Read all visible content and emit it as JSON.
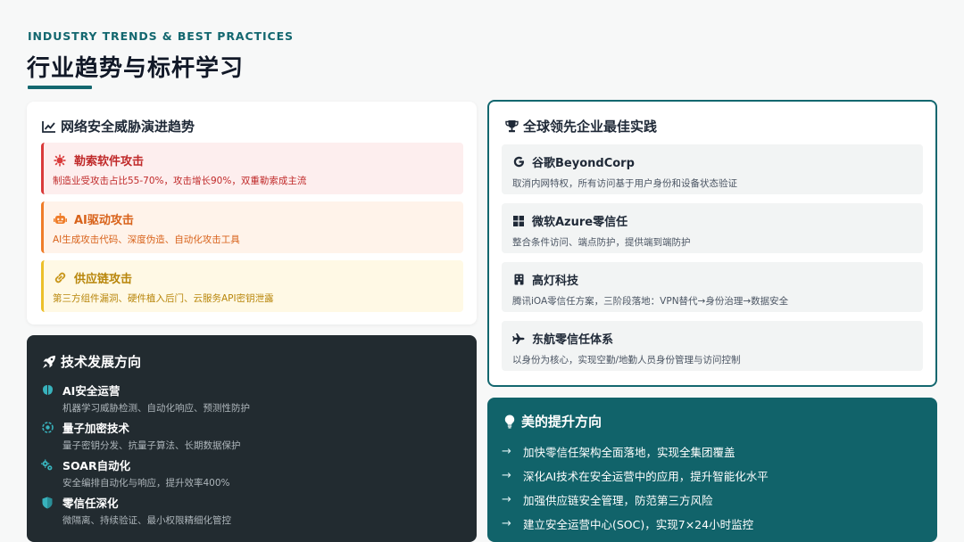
{
  "header": {
    "eyebrow": "INDUSTRY TRENDS & BEST PRACTICES",
    "title": "行业趋势与标杆学习"
  },
  "threats": {
    "title": "网络安全威胁演进趋势",
    "icon": "trend-chart-icon",
    "items": [
      {
        "title": "勒索软件攻击",
        "desc": "制造业受攻击占比55-70%，攻击增长90%，双重勒索成主流",
        "icon": "virus-icon",
        "color": "#d93a3a"
      },
      {
        "title": "AI驱动攻击",
        "desc": "AI生成攻击代码、深度伪造、自动化攻击工具",
        "icon": "robot-icon",
        "color": "#ef7d2a"
      },
      {
        "title": "供应链攻击",
        "desc": "第三方组件漏洞、硬件植入后门、云服务API密钥泄露",
        "icon": "link-icon",
        "color": "#ecc02a"
      }
    ]
  },
  "tech": {
    "title": "技术发展方向",
    "icon": "rocket-icon",
    "items": [
      {
        "title": "AI安全运营",
        "desc": "机器学习威胁检测、自动化响应、预测性防护",
        "icon": "brain-icon"
      },
      {
        "title": "量子加密技术",
        "desc": "量子密钥分发、抗量子算法、长期数据保护",
        "icon": "atom-icon"
      },
      {
        "title": "SOAR自动化",
        "desc": "安全编排自动化与响应，提升效率400%",
        "icon": "cogs-icon"
      },
      {
        "title": "零信任深化",
        "desc": "微隔离、持续验证、最小权限精细化管控",
        "icon": "shield-icon"
      }
    ]
  },
  "best": {
    "title": "全球领先企业最佳实践",
    "icon": "trophy-icon",
    "items": [
      {
        "title": "谷歌BeyondCorp",
        "desc": "取消内网特权，所有访问基于用户身份和设备状态验证",
        "icon": "google-icon"
      },
      {
        "title": "微软Azure零信任",
        "desc": "整合条件访问、端点防护，提供端到端防护",
        "icon": "windows-icon"
      },
      {
        "title": "高灯科技",
        "desc": "腾讯iOA零信任方案，三阶段落地：VPN替代→身份治理→数据安全",
        "icon": "building-icon"
      },
      {
        "title": "东航零信任体系",
        "desc": "以身份为核心，实现空勤/地勤人员身份管理与访问控制",
        "icon": "plane-icon"
      }
    ]
  },
  "directions": {
    "title": "美的提升方向",
    "icon": "lightbulb-icon",
    "items": [
      "加快零信任架构全面落地，实现全集团覆盖",
      "深化AI技术在安全运营中的应用，提升智能化水平",
      "加强供应链安全管理，防范第三方风险",
      "建立安全运营中心(SOC)，实现7×24小时监控"
    ]
  },
  "colors": {
    "accent": "#13676f",
    "dark": "#222b30",
    "teal_panel": "#11636a"
  }
}
